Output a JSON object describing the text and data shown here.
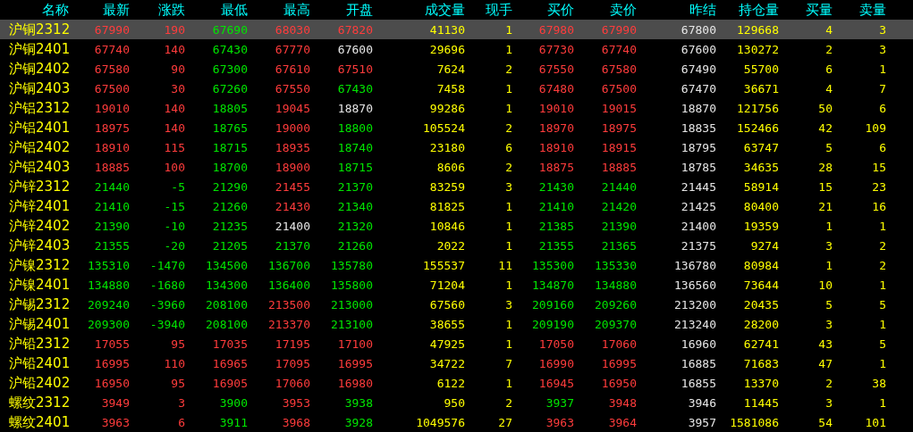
{
  "columns": [
    "名称",
    "最新",
    "涨跌",
    "最低",
    "最高",
    "开盘",
    "成交量",
    "现手",
    "买价",
    "卖价",
    "昨结",
    "持仓量",
    "买量",
    "卖量"
  ],
  "rows": [
    {
      "name": "沪铜2312",
      "selected": true,
      "cells": [
        {
          "text": "67990",
          "color": "#ff3c3c"
        },
        {
          "text": "190",
          "color": "#ff3c3c"
        },
        {
          "text": "67690",
          "color": "#00e600"
        },
        {
          "text": "68030",
          "color": "#ff3c3c"
        },
        {
          "text": "67820",
          "color": "#ff3c3c"
        },
        {
          "text": "41130",
          "color": "#ffff00"
        },
        {
          "text": "1",
          "color": "#ffff00"
        },
        {
          "text": "67980",
          "color": "#ff3c3c"
        },
        {
          "text": "67990",
          "color": "#ff3c3c"
        },
        {
          "text": "67800",
          "color": "#e6e6e6"
        },
        {
          "text": "129668",
          "color": "#ffff00"
        },
        {
          "text": "4",
          "color": "#ffff00"
        },
        {
          "text": "3",
          "color": "#ffff00"
        }
      ]
    },
    {
      "name": "沪铜2401",
      "selected": false,
      "cells": [
        {
          "text": "67740",
          "color": "#ff3c3c"
        },
        {
          "text": "140",
          "color": "#ff3c3c"
        },
        {
          "text": "67430",
          "color": "#00e600"
        },
        {
          "text": "67770",
          "color": "#ff3c3c"
        },
        {
          "text": "67600",
          "color": "#e6e6e6"
        },
        {
          "text": "29696",
          "color": "#ffff00"
        },
        {
          "text": "1",
          "color": "#ffff00"
        },
        {
          "text": "67730",
          "color": "#ff3c3c"
        },
        {
          "text": "67740",
          "color": "#ff3c3c"
        },
        {
          "text": "67600",
          "color": "#e6e6e6"
        },
        {
          "text": "130272",
          "color": "#ffff00"
        },
        {
          "text": "2",
          "color": "#ffff00"
        },
        {
          "text": "3",
          "color": "#ffff00"
        }
      ]
    },
    {
      "name": "沪铜2402",
      "selected": false,
      "cells": [
        {
          "text": "67580",
          "color": "#ff3c3c"
        },
        {
          "text": "90",
          "color": "#ff3c3c"
        },
        {
          "text": "67300",
          "color": "#00e600"
        },
        {
          "text": "67610",
          "color": "#ff3c3c"
        },
        {
          "text": "67510",
          "color": "#ff3c3c"
        },
        {
          "text": "7624",
          "color": "#ffff00"
        },
        {
          "text": "2",
          "color": "#ffff00"
        },
        {
          "text": "67550",
          "color": "#ff3c3c"
        },
        {
          "text": "67580",
          "color": "#ff3c3c"
        },
        {
          "text": "67490",
          "color": "#e6e6e6"
        },
        {
          "text": "55700",
          "color": "#ffff00"
        },
        {
          "text": "6",
          "color": "#ffff00"
        },
        {
          "text": "1",
          "color": "#ffff00"
        }
      ]
    },
    {
      "name": "沪铜2403",
      "selected": false,
      "cells": [
        {
          "text": "67500",
          "color": "#ff3c3c"
        },
        {
          "text": "30",
          "color": "#ff3c3c"
        },
        {
          "text": "67260",
          "color": "#00e600"
        },
        {
          "text": "67550",
          "color": "#ff3c3c"
        },
        {
          "text": "67430",
          "color": "#00e600"
        },
        {
          "text": "7458",
          "color": "#ffff00"
        },
        {
          "text": "1",
          "color": "#ffff00"
        },
        {
          "text": "67480",
          "color": "#ff3c3c"
        },
        {
          "text": "67500",
          "color": "#ff3c3c"
        },
        {
          "text": "67470",
          "color": "#e6e6e6"
        },
        {
          "text": "36671",
          "color": "#ffff00"
        },
        {
          "text": "4",
          "color": "#ffff00"
        },
        {
          "text": "7",
          "color": "#ffff00"
        }
      ]
    },
    {
      "name": "沪铝2312",
      "selected": false,
      "cells": [
        {
          "text": "19010",
          "color": "#ff3c3c"
        },
        {
          "text": "140",
          "color": "#ff3c3c"
        },
        {
          "text": "18805",
          "color": "#00e600"
        },
        {
          "text": "19045",
          "color": "#ff3c3c"
        },
        {
          "text": "18870",
          "color": "#e6e6e6"
        },
        {
          "text": "99286",
          "color": "#ffff00"
        },
        {
          "text": "1",
          "color": "#ffff00"
        },
        {
          "text": "19010",
          "color": "#ff3c3c"
        },
        {
          "text": "19015",
          "color": "#ff3c3c"
        },
        {
          "text": "18870",
          "color": "#e6e6e6"
        },
        {
          "text": "121756",
          "color": "#ffff00"
        },
        {
          "text": "50",
          "color": "#ffff00"
        },
        {
          "text": "6",
          "color": "#ffff00"
        }
      ]
    },
    {
      "name": "沪铝2401",
      "selected": false,
      "cells": [
        {
          "text": "18975",
          "color": "#ff3c3c"
        },
        {
          "text": "140",
          "color": "#ff3c3c"
        },
        {
          "text": "18765",
          "color": "#00e600"
        },
        {
          "text": "19000",
          "color": "#ff3c3c"
        },
        {
          "text": "18800",
          "color": "#00e600"
        },
        {
          "text": "105524",
          "color": "#ffff00"
        },
        {
          "text": "2",
          "color": "#ffff00"
        },
        {
          "text": "18970",
          "color": "#ff3c3c"
        },
        {
          "text": "18975",
          "color": "#ff3c3c"
        },
        {
          "text": "18835",
          "color": "#e6e6e6"
        },
        {
          "text": "152466",
          "color": "#ffff00"
        },
        {
          "text": "42",
          "color": "#ffff00"
        },
        {
          "text": "109",
          "color": "#ffff00"
        }
      ]
    },
    {
      "name": "沪铝2402",
      "selected": false,
      "cells": [
        {
          "text": "18910",
          "color": "#ff3c3c"
        },
        {
          "text": "115",
          "color": "#ff3c3c"
        },
        {
          "text": "18715",
          "color": "#00e600"
        },
        {
          "text": "18935",
          "color": "#ff3c3c"
        },
        {
          "text": "18740",
          "color": "#00e600"
        },
        {
          "text": "23180",
          "color": "#ffff00"
        },
        {
          "text": "6",
          "color": "#ffff00"
        },
        {
          "text": "18910",
          "color": "#ff3c3c"
        },
        {
          "text": "18915",
          "color": "#ff3c3c"
        },
        {
          "text": "18795",
          "color": "#e6e6e6"
        },
        {
          "text": "63747",
          "color": "#ffff00"
        },
        {
          "text": "5",
          "color": "#ffff00"
        },
        {
          "text": "6",
          "color": "#ffff00"
        }
      ]
    },
    {
      "name": "沪铝2403",
      "selected": false,
      "cells": [
        {
          "text": "18885",
          "color": "#ff3c3c"
        },
        {
          "text": "100",
          "color": "#ff3c3c"
        },
        {
          "text": "18700",
          "color": "#00e600"
        },
        {
          "text": "18900",
          "color": "#ff3c3c"
        },
        {
          "text": "18715",
          "color": "#00e600"
        },
        {
          "text": "8606",
          "color": "#ffff00"
        },
        {
          "text": "2",
          "color": "#ffff00"
        },
        {
          "text": "18875",
          "color": "#ff3c3c"
        },
        {
          "text": "18885",
          "color": "#ff3c3c"
        },
        {
          "text": "18785",
          "color": "#e6e6e6"
        },
        {
          "text": "34635",
          "color": "#ffff00"
        },
        {
          "text": "28",
          "color": "#ffff00"
        },
        {
          "text": "15",
          "color": "#ffff00"
        }
      ]
    },
    {
      "name": "沪锌2312",
      "selected": false,
      "cells": [
        {
          "text": "21440",
          "color": "#00e600"
        },
        {
          "text": "-5",
          "color": "#00e600"
        },
        {
          "text": "21290",
          "color": "#00e600"
        },
        {
          "text": "21455",
          "color": "#ff3c3c"
        },
        {
          "text": "21370",
          "color": "#00e600"
        },
        {
          "text": "83259",
          "color": "#ffff00"
        },
        {
          "text": "3",
          "color": "#ffff00"
        },
        {
          "text": "21430",
          "color": "#00e600"
        },
        {
          "text": "21440",
          "color": "#00e600"
        },
        {
          "text": "21445",
          "color": "#e6e6e6"
        },
        {
          "text": "58914",
          "color": "#ffff00"
        },
        {
          "text": "15",
          "color": "#ffff00"
        },
        {
          "text": "23",
          "color": "#ffff00"
        }
      ]
    },
    {
      "name": "沪锌2401",
      "selected": false,
      "cells": [
        {
          "text": "21410",
          "color": "#00e600"
        },
        {
          "text": "-15",
          "color": "#00e600"
        },
        {
          "text": "21260",
          "color": "#00e600"
        },
        {
          "text": "21430",
          "color": "#ff3c3c"
        },
        {
          "text": "21340",
          "color": "#00e600"
        },
        {
          "text": "81825",
          "color": "#ffff00"
        },
        {
          "text": "1",
          "color": "#ffff00"
        },
        {
          "text": "21410",
          "color": "#00e600"
        },
        {
          "text": "21420",
          "color": "#00e600"
        },
        {
          "text": "21425",
          "color": "#e6e6e6"
        },
        {
          "text": "80400",
          "color": "#ffff00"
        },
        {
          "text": "21",
          "color": "#ffff00"
        },
        {
          "text": "16",
          "color": "#ffff00"
        }
      ]
    },
    {
      "name": "沪锌2402",
      "selected": false,
      "cells": [
        {
          "text": "21390",
          "color": "#00e600"
        },
        {
          "text": "-10",
          "color": "#00e600"
        },
        {
          "text": "21235",
          "color": "#00e600"
        },
        {
          "text": "21400",
          "color": "#e6e6e6"
        },
        {
          "text": "21320",
          "color": "#00e600"
        },
        {
          "text": "10846",
          "color": "#ffff00"
        },
        {
          "text": "1",
          "color": "#ffff00"
        },
        {
          "text": "21385",
          "color": "#00e600"
        },
        {
          "text": "21390",
          "color": "#00e600"
        },
        {
          "text": "21400",
          "color": "#e6e6e6"
        },
        {
          "text": "19359",
          "color": "#ffff00"
        },
        {
          "text": "1",
          "color": "#ffff00"
        },
        {
          "text": "1",
          "color": "#ffff00"
        }
      ]
    },
    {
      "name": "沪锌2403",
      "selected": false,
      "cells": [
        {
          "text": "21355",
          "color": "#00e600"
        },
        {
          "text": "-20",
          "color": "#00e600"
        },
        {
          "text": "21205",
          "color": "#00e600"
        },
        {
          "text": "21370",
          "color": "#00e600"
        },
        {
          "text": "21260",
          "color": "#00e600"
        },
        {
          "text": "2022",
          "color": "#ffff00"
        },
        {
          "text": "1",
          "color": "#ffff00"
        },
        {
          "text": "21355",
          "color": "#00e600"
        },
        {
          "text": "21365",
          "color": "#00e600"
        },
        {
          "text": "21375",
          "color": "#e6e6e6"
        },
        {
          "text": "9274",
          "color": "#ffff00"
        },
        {
          "text": "3",
          "color": "#ffff00"
        },
        {
          "text": "2",
          "color": "#ffff00"
        }
      ]
    },
    {
      "name": "沪镍2312",
      "selected": false,
      "cells": [
        {
          "text": "135310",
          "color": "#00e600"
        },
        {
          "text": "-1470",
          "color": "#00e600"
        },
        {
          "text": "134500",
          "color": "#00e600"
        },
        {
          "text": "136700",
          "color": "#00e600"
        },
        {
          "text": "135780",
          "color": "#00e600"
        },
        {
          "text": "155537",
          "color": "#ffff00"
        },
        {
          "text": "11",
          "color": "#ffff00"
        },
        {
          "text": "135300",
          "color": "#00e600"
        },
        {
          "text": "135330",
          "color": "#00e600"
        },
        {
          "text": "136780",
          "color": "#e6e6e6"
        },
        {
          "text": "80984",
          "color": "#ffff00"
        },
        {
          "text": "1",
          "color": "#ffff00"
        },
        {
          "text": "2",
          "color": "#ffff00"
        }
      ]
    },
    {
      "name": "沪镍2401",
      "selected": false,
      "cells": [
        {
          "text": "134880",
          "color": "#00e600"
        },
        {
          "text": "-1680",
          "color": "#00e600"
        },
        {
          "text": "134300",
          "color": "#00e600"
        },
        {
          "text": "136400",
          "color": "#00e600"
        },
        {
          "text": "135800",
          "color": "#00e600"
        },
        {
          "text": "71204",
          "color": "#ffff00"
        },
        {
          "text": "1",
          "color": "#ffff00"
        },
        {
          "text": "134870",
          "color": "#00e600"
        },
        {
          "text": "134880",
          "color": "#00e600"
        },
        {
          "text": "136560",
          "color": "#e6e6e6"
        },
        {
          "text": "73644",
          "color": "#ffff00"
        },
        {
          "text": "10",
          "color": "#ffff00"
        },
        {
          "text": "1",
          "color": "#ffff00"
        }
      ]
    },
    {
      "name": "沪锡2312",
      "selected": false,
      "cells": [
        {
          "text": "209240",
          "color": "#00e600"
        },
        {
          "text": "-3960",
          "color": "#00e600"
        },
        {
          "text": "208100",
          "color": "#00e600"
        },
        {
          "text": "213500",
          "color": "#ff3c3c"
        },
        {
          "text": "213000",
          "color": "#00e600"
        },
        {
          "text": "67560",
          "color": "#ffff00"
        },
        {
          "text": "3",
          "color": "#ffff00"
        },
        {
          "text": "209160",
          "color": "#00e600"
        },
        {
          "text": "209260",
          "color": "#00e600"
        },
        {
          "text": "213200",
          "color": "#e6e6e6"
        },
        {
          "text": "20435",
          "color": "#ffff00"
        },
        {
          "text": "5",
          "color": "#ffff00"
        },
        {
          "text": "5",
          "color": "#ffff00"
        }
      ]
    },
    {
      "name": "沪锡2401",
      "selected": false,
      "cells": [
        {
          "text": "209300",
          "color": "#00e600"
        },
        {
          "text": "-3940",
          "color": "#00e600"
        },
        {
          "text": "208100",
          "color": "#00e600"
        },
        {
          "text": "213370",
          "color": "#ff3c3c"
        },
        {
          "text": "213100",
          "color": "#00e600"
        },
        {
          "text": "38655",
          "color": "#ffff00"
        },
        {
          "text": "1",
          "color": "#ffff00"
        },
        {
          "text": "209190",
          "color": "#00e600"
        },
        {
          "text": "209370",
          "color": "#00e600"
        },
        {
          "text": "213240",
          "color": "#e6e6e6"
        },
        {
          "text": "28200",
          "color": "#ffff00"
        },
        {
          "text": "3",
          "color": "#ffff00"
        },
        {
          "text": "1",
          "color": "#ffff00"
        }
      ]
    },
    {
      "name": "沪铅2312",
      "selected": false,
      "cells": [
        {
          "text": "17055",
          "color": "#ff3c3c"
        },
        {
          "text": "95",
          "color": "#ff3c3c"
        },
        {
          "text": "17035",
          "color": "#ff3c3c"
        },
        {
          "text": "17195",
          "color": "#ff3c3c"
        },
        {
          "text": "17100",
          "color": "#ff3c3c"
        },
        {
          "text": "47925",
          "color": "#ffff00"
        },
        {
          "text": "1",
          "color": "#ffff00"
        },
        {
          "text": "17050",
          "color": "#ff3c3c"
        },
        {
          "text": "17060",
          "color": "#ff3c3c"
        },
        {
          "text": "16960",
          "color": "#e6e6e6"
        },
        {
          "text": "62741",
          "color": "#ffff00"
        },
        {
          "text": "43",
          "color": "#ffff00"
        },
        {
          "text": "5",
          "color": "#ffff00"
        }
      ]
    },
    {
      "name": "沪铅2401",
      "selected": false,
      "cells": [
        {
          "text": "16995",
          "color": "#ff3c3c"
        },
        {
          "text": "110",
          "color": "#ff3c3c"
        },
        {
          "text": "16965",
          "color": "#ff3c3c"
        },
        {
          "text": "17095",
          "color": "#ff3c3c"
        },
        {
          "text": "16995",
          "color": "#ff3c3c"
        },
        {
          "text": "34722",
          "color": "#ffff00"
        },
        {
          "text": "7",
          "color": "#ffff00"
        },
        {
          "text": "16990",
          "color": "#ff3c3c"
        },
        {
          "text": "16995",
          "color": "#ff3c3c"
        },
        {
          "text": "16885",
          "color": "#e6e6e6"
        },
        {
          "text": "71683",
          "color": "#ffff00"
        },
        {
          "text": "47",
          "color": "#ffff00"
        },
        {
          "text": "1",
          "color": "#ffff00"
        }
      ]
    },
    {
      "name": "沪铅2402",
      "selected": false,
      "cells": [
        {
          "text": "16950",
          "color": "#ff3c3c"
        },
        {
          "text": "95",
          "color": "#ff3c3c"
        },
        {
          "text": "16905",
          "color": "#ff3c3c"
        },
        {
          "text": "17060",
          "color": "#ff3c3c"
        },
        {
          "text": "16980",
          "color": "#ff3c3c"
        },
        {
          "text": "6122",
          "color": "#ffff00"
        },
        {
          "text": "1",
          "color": "#ffff00"
        },
        {
          "text": "16945",
          "color": "#ff3c3c"
        },
        {
          "text": "16950",
          "color": "#ff3c3c"
        },
        {
          "text": "16855",
          "color": "#e6e6e6"
        },
        {
          "text": "13370",
          "color": "#ffff00"
        },
        {
          "text": "2",
          "color": "#ffff00"
        },
        {
          "text": "38",
          "color": "#ffff00"
        }
      ]
    },
    {
      "name": "螺纹2312",
      "selected": false,
      "cells": [
        {
          "text": "3949",
          "color": "#ff3c3c"
        },
        {
          "text": "3",
          "color": "#ff3c3c"
        },
        {
          "text": "3900",
          "color": "#00e600"
        },
        {
          "text": "3953",
          "color": "#ff3c3c"
        },
        {
          "text": "3938",
          "color": "#00e600"
        },
        {
          "text": "950",
          "color": "#ffff00"
        },
        {
          "text": "2",
          "color": "#ffff00"
        },
        {
          "text": "3937",
          "color": "#00e600"
        },
        {
          "text": "3948",
          "color": "#ff3c3c"
        },
        {
          "text": "3946",
          "color": "#e6e6e6"
        },
        {
          "text": "11445",
          "color": "#ffff00"
        },
        {
          "text": "3",
          "color": "#ffff00"
        },
        {
          "text": "1",
          "color": "#ffff00"
        }
      ]
    },
    {
      "name": "螺纹2401",
      "selected": false,
      "cells": [
        {
          "text": "3963",
          "color": "#ff3c3c"
        },
        {
          "text": "6",
          "color": "#ff3c3c"
        },
        {
          "text": "3911",
          "color": "#00e600"
        },
        {
          "text": "3968",
          "color": "#ff3c3c"
        },
        {
          "text": "3928",
          "color": "#00e600"
        },
        {
          "text": "1049576",
          "color": "#ffff00"
        },
        {
          "text": "27",
          "color": "#ffff00"
        },
        {
          "text": "3963",
          "color": "#ff3c3c"
        },
        {
          "text": "3964",
          "color": "#ff3c3c"
        },
        {
          "text": "3957",
          "color": "#e6e6e6"
        },
        {
          "text": "1581086",
          "color": "#ffff00"
        },
        {
          "text": "54",
          "color": "#ffff00"
        },
        {
          "text": "101",
          "color": "#ffff00"
        }
      ]
    }
  ]
}
